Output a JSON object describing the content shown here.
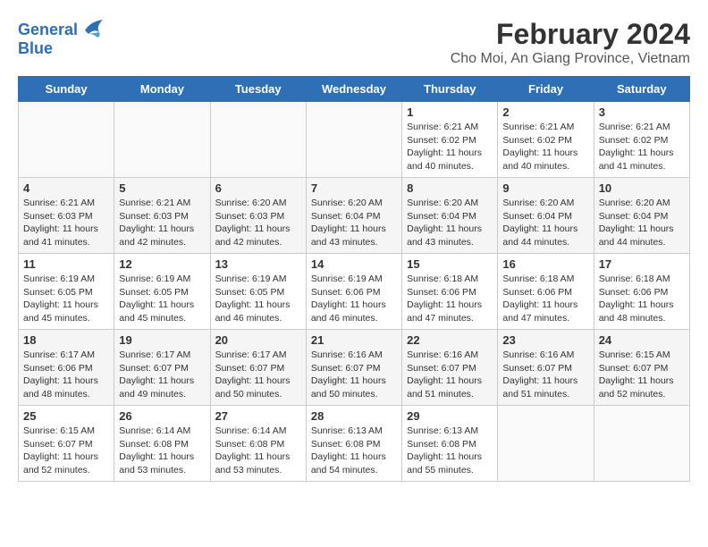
{
  "logo": {
    "text_general": "General",
    "text_blue": "Blue"
  },
  "title": "February 2024",
  "subtitle": "Cho Moi, An Giang Province, Vietnam",
  "weekdays": [
    "Sunday",
    "Monday",
    "Tuesday",
    "Wednesday",
    "Thursday",
    "Friday",
    "Saturday"
  ],
  "weeks": [
    [
      {
        "day": "",
        "sunrise": "",
        "sunset": "",
        "daylight": ""
      },
      {
        "day": "",
        "sunrise": "",
        "sunset": "",
        "daylight": ""
      },
      {
        "day": "",
        "sunrise": "",
        "sunset": "",
        "daylight": ""
      },
      {
        "day": "",
        "sunrise": "",
        "sunset": "",
        "daylight": ""
      },
      {
        "day": "1",
        "sunrise": "Sunrise: 6:21 AM",
        "sunset": "Sunset: 6:02 PM",
        "daylight": "Daylight: 11 hours and 40 minutes."
      },
      {
        "day": "2",
        "sunrise": "Sunrise: 6:21 AM",
        "sunset": "Sunset: 6:02 PM",
        "daylight": "Daylight: 11 hours and 40 minutes."
      },
      {
        "day": "3",
        "sunrise": "Sunrise: 6:21 AM",
        "sunset": "Sunset: 6:02 PM",
        "daylight": "Daylight: 11 hours and 41 minutes."
      }
    ],
    [
      {
        "day": "4",
        "sunrise": "Sunrise: 6:21 AM",
        "sunset": "Sunset: 6:03 PM",
        "daylight": "Daylight: 11 hours and 41 minutes."
      },
      {
        "day": "5",
        "sunrise": "Sunrise: 6:21 AM",
        "sunset": "Sunset: 6:03 PM",
        "daylight": "Daylight: 11 hours and 42 minutes."
      },
      {
        "day": "6",
        "sunrise": "Sunrise: 6:20 AM",
        "sunset": "Sunset: 6:03 PM",
        "daylight": "Daylight: 11 hours and 42 minutes."
      },
      {
        "day": "7",
        "sunrise": "Sunrise: 6:20 AM",
        "sunset": "Sunset: 6:04 PM",
        "daylight": "Daylight: 11 hours and 43 minutes."
      },
      {
        "day": "8",
        "sunrise": "Sunrise: 6:20 AM",
        "sunset": "Sunset: 6:04 PM",
        "daylight": "Daylight: 11 hours and 43 minutes."
      },
      {
        "day": "9",
        "sunrise": "Sunrise: 6:20 AM",
        "sunset": "Sunset: 6:04 PM",
        "daylight": "Daylight: 11 hours and 44 minutes."
      },
      {
        "day": "10",
        "sunrise": "Sunrise: 6:20 AM",
        "sunset": "Sunset: 6:04 PM",
        "daylight": "Daylight: 11 hours and 44 minutes."
      }
    ],
    [
      {
        "day": "11",
        "sunrise": "Sunrise: 6:19 AM",
        "sunset": "Sunset: 6:05 PM",
        "daylight": "Daylight: 11 hours and 45 minutes."
      },
      {
        "day": "12",
        "sunrise": "Sunrise: 6:19 AM",
        "sunset": "Sunset: 6:05 PM",
        "daylight": "Daylight: 11 hours and 45 minutes."
      },
      {
        "day": "13",
        "sunrise": "Sunrise: 6:19 AM",
        "sunset": "Sunset: 6:05 PM",
        "daylight": "Daylight: 11 hours and 46 minutes."
      },
      {
        "day": "14",
        "sunrise": "Sunrise: 6:19 AM",
        "sunset": "Sunset: 6:06 PM",
        "daylight": "Daylight: 11 hours and 46 minutes."
      },
      {
        "day": "15",
        "sunrise": "Sunrise: 6:18 AM",
        "sunset": "Sunset: 6:06 PM",
        "daylight": "Daylight: 11 hours and 47 minutes."
      },
      {
        "day": "16",
        "sunrise": "Sunrise: 6:18 AM",
        "sunset": "Sunset: 6:06 PM",
        "daylight": "Daylight: 11 hours and 47 minutes."
      },
      {
        "day": "17",
        "sunrise": "Sunrise: 6:18 AM",
        "sunset": "Sunset: 6:06 PM",
        "daylight": "Daylight: 11 hours and 48 minutes."
      }
    ],
    [
      {
        "day": "18",
        "sunrise": "Sunrise: 6:17 AM",
        "sunset": "Sunset: 6:06 PM",
        "daylight": "Daylight: 11 hours and 48 minutes."
      },
      {
        "day": "19",
        "sunrise": "Sunrise: 6:17 AM",
        "sunset": "Sunset: 6:07 PM",
        "daylight": "Daylight: 11 hours and 49 minutes."
      },
      {
        "day": "20",
        "sunrise": "Sunrise: 6:17 AM",
        "sunset": "Sunset: 6:07 PM",
        "daylight": "Daylight: 11 hours and 50 minutes."
      },
      {
        "day": "21",
        "sunrise": "Sunrise: 6:16 AM",
        "sunset": "Sunset: 6:07 PM",
        "daylight": "Daylight: 11 hours and 50 minutes."
      },
      {
        "day": "22",
        "sunrise": "Sunrise: 6:16 AM",
        "sunset": "Sunset: 6:07 PM",
        "daylight": "Daylight: 11 hours and 51 minutes."
      },
      {
        "day": "23",
        "sunrise": "Sunrise: 6:16 AM",
        "sunset": "Sunset: 6:07 PM",
        "daylight": "Daylight: 11 hours and 51 minutes."
      },
      {
        "day": "24",
        "sunrise": "Sunrise: 6:15 AM",
        "sunset": "Sunset: 6:07 PM",
        "daylight": "Daylight: 11 hours and 52 minutes."
      }
    ],
    [
      {
        "day": "25",
        "sunrise": "Sunrise: 6:15 AM",
        "sunset": "Sunset: 6:07 PM",
        "daylight": "Daylight: 11 hours and 52 minutes."
      },
      {
        "day": "26",
        "sunrise": "Sunrise: 6:14 AM",
        "sunset": "Sunset: 6:08 PM",
        "daylight": "Daylight: 11 hours and 53 minutes."
      },
      {
        "day": "27",
        "sunrise": "Sunrise: 6:14 AM",
        "sunset": "Sunset: 6:08 PM",
        "daylight": "Daylight: 11 hours and 53 minutes."
      },
      {
        "day": "28",
        "sunrise": "Sunrise: 6:13 AM",
        "sunset": "Sunset: 6:08 PM",
        "daylight": "Daylight: 11 hours and 54 minutes."
      },
      {
        "day": "29",
        "sunrise": "Sunrise: 6:13 AM",
        "sunset": "Sunset: 6:08 PM",
        "daylight": "Daylight: 11 hours and 55 minutes."
      },
      {
        "day": "",
        "sunrise": "",
        "sunset": "",
        "daylight": ""
      },
      {
        "day": "",
        "sunrise": "",
        "sunset": "",
        "daylight": ""
      }
    ]
  ]
}
